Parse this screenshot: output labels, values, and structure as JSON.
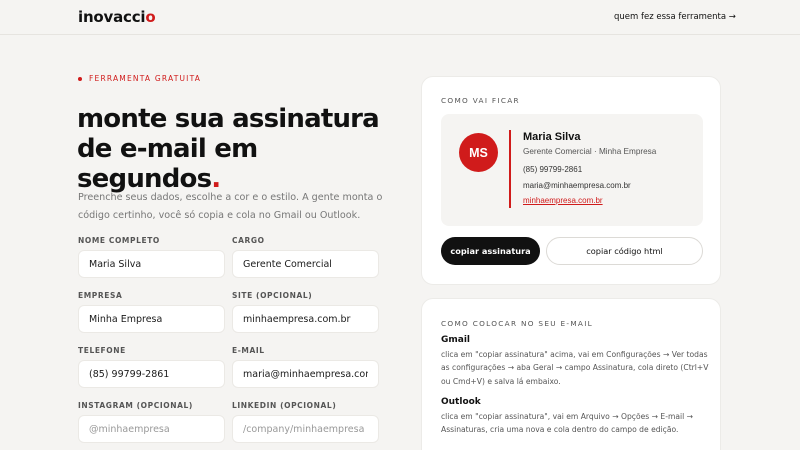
{
  "header": {
    "logo": "inovacci",
    "logo_dot": "o",
    "credits_link": "quem fez essa ferramenta →"
  },
  "hero": {
    "eyebrow": "FERRAMENTA GRATUITA",
    "headline_line1": "monte sua assinatura",
    "headline_line2": "de e-mail em segundos",
    "headline_dot": ".",
    "intro": "Preenche seus dados, escolhe a cor e o estilo. A gente monta o código certinho, você só copia e cola no Gmail ou Outlook."
  },
  "form": {
    "full_name": {
      "label": "NOME COMPLETO",
      "value": "Maria Silva",
      "placeholder": ""
    },
    "job_title": {
      "label": "CARGO",
      "value": "Gerente Comercial",
      "placeholder": ""
    },
    "company": {
      "label": "EMPRESA",
      "value": "Minha Empresa",
      "placeholder": ""
    },
    "website": {
      "label": "SITE (OPCIONAL)",
      "value": "minhaempresa.com.br",
      "placeholder": ""
    },
    "phone": {
      "label": "TELEFONE",
      "value": "(85) 99799-2861",
      "placeholder": ""
    },
    "email": {
      "label": "E-MAIL",
      "value": "maria@minhaempresa.com.br",
      "placeholder": ""
    },
    "instagram": {
      "label": "INSTAGRAM (OPCIONAL)",
      "value": "",
      "placeholder": "@minhaempresa"
    },
    "linkedin": {
      "label": "LINKEDIN (OPCIONAL)",
      "value": "",
      "placeholder": "/company/minhaempresa"
    }
  },
  "preview": {
    "eyebrow": "COMO VAI FICAR",
    "initials": "MS",
    "name": "Maria Silva",
    "role_line": "Gerente Comercial · Minha Empresa",
    "phone": "(85) 99799-2861",
    "email": "maria@minhaempresa.com.br",
    "site": "minhaempresa.com.br",
    "copy_signature_label": "copiar assinatura",
    "copy_html_label": "copiar código html"
  },
  "instructions": {
    "eyebrow": "COMO COLOCAR NO SEU E-MAIL",
    "gmail_title": "Gmail",
    "gmail_text": "clica em \"copiar assinatura\" acima, vai em Configurações → Ver todas as configurações → aba Geral → campo Assinatura, cola direto (Ctrl+V ou Cmd+V) e salva lá embaixo.",
    "outlook_title": "Outlook",
    "outlook_text": "clica em \"copiar assinatura\", vai em Arquivo → Opções → E-mail → Assinaturas, cria uma nova e cola dentro do campo de edição."
  },
  "colors": {
    "accent": "#d01b1b",
    "background": "#f5f4f2",
    "dark": "#111111"
  }
}
